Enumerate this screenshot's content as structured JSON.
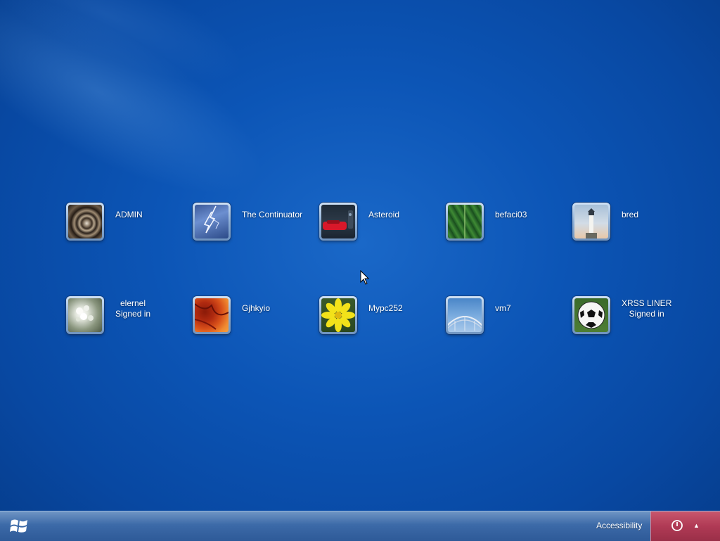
{
  "users": [
    {
      "name": "ADMIN",
      "status": "",
      "picture": "nautilus-shell-picture"
    },
    {
      "name": "The Continuator",
      "status": "",
      "picture": "lightning-picture"
    },
    {
      "name": "Asteroid",
      "status": "",
      "picture": "red-car-picture"
    },
    {
      "name": "befaci03",
      "status": "",
      "picture": "green-leaf-picture"
    },
    {
      "name": "bred",
      "status": "",
      "picture": "lighthouse-picture"
    },
    {
      "name": "elernel",
      "status": "Signed in",
      "picture": "white-flowers-picture"
    },
    {
      "name": "Gjhkyio",
      "status": "",
      "picture": "orange-flower-picture"
    },
    {
      "name": "Mypc252",
      "status": "",
      "picture": "yellow-daisy-picture"
    },
    {
      "name": "vm7",
      "status": "",
      "picture": "bridge-arch-picture"
    },
    {
      "name": "XRSS LINER",
      "status": "Signed in",
      "picture": "soccer-ball-picture"
    }
  ],
  "taskbar": {
    "accessibility_label": "Accessibility"
  },
  "colors": {
    "background": "#0c55b6",
    "taskbar": "#3c6aa8",
    "power_button": "#b03a55"
  }
}
